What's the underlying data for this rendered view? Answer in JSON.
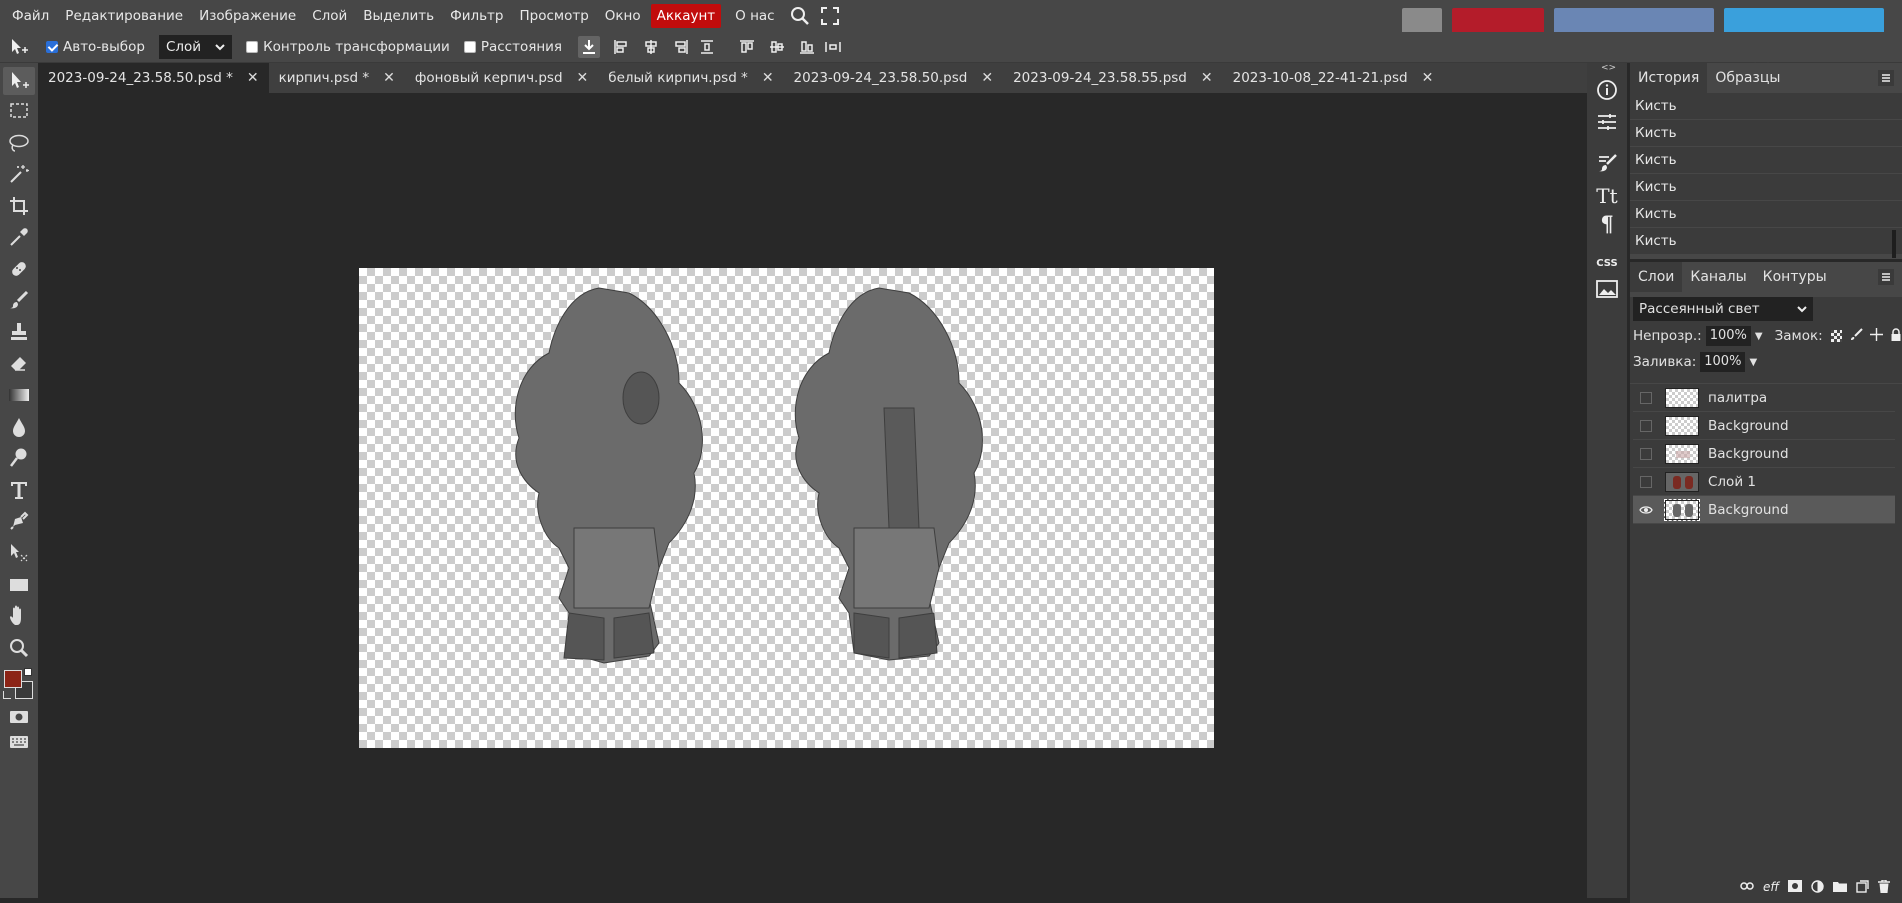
{
  "menubar": {
    "items": [
      "Файл",
      "Редактирование",
      "Изображение",
      "Слой",
      "Выделить",
      "Фильтр",
      "Просмотр",
      "Окно"
    ],
    "account": "Аккаунт",
    "about": "О нас"
  },
  "options": {
    "auto_select_label": "Авто-выбор",
    "auto_select_checked": true,
    "layer_select_value": "Слой",
    "transform_controls_label": "Контроль трансформации",
    "distances_label": "Расстояния"
  },
  "tabs": [
    {
      "label": "2023-09-24_23.58.50.psd *",
      "active": true
    },
    {
      "label": "кирпич.psd *",
      "active": false
    },
    {
      "label": "фоновый керпич.psd",
      "active": false
    },
    {
      "label": "белый кирпич.psd *",
      "active": false
    },
    {
      "label": "2023-09-24_23.58.50.psd",
      "active": false
    },
    {
      "label": "2023-09-24_23.58.55.psd",
      "active": false
    },
    {
      "label": "2023-10-08_22-41-21.psd",
      "active": false
    }
  ],
  "colors": {
    "foreground": "#8c2416",
    "background": "#3a3a3a",
    "account_red": "#c10c0c",
    "selected_layer": "#5a5a5a"
  },
  "history_panel": {
    "tabs": [
      "История",
      "Образцы"
    ],
    "items": [
      "Кисть",
      "Кисть",
      "Кисть",
      "Кисть",
      "Кисть",
      "Кисть"
    ]
  },
  "layers_panel": {
    "tabs": [
      "Слои",
      "Каналы",
      "Контуры"
    ],
    "blend_mode": "Рассеянный свет",
    "opacity_label": "Непрозр.:",
    "opacity_value": "100%",
    "lock_label": "Замок:",
    "fill_label": "Заливка:",
    "fill_value": "100%",
    "layers": [
      {
        "name": "палитра",
        "visible": false,
        "selected": false
      },
      {
        "name": "Background",
        "visible": false,
        "selected": false
      },
      {
        "name": "Background",
        "visible": false,
        "selected": false
      },
      {
        "name": "Слой 1",
        "visible": false,
        "selected": false
      },
      {
        "name": "Background",
        "visible": true,
        "selected": true
      }
    ]
  },
  "sidebar": {
    "css_label": "CSS"
  },
  "icons": {
    "tools": [
      "move-tool-icon",
      "marquee-tool-icon",
      "lasso-tool-icon",
      "magic-wand-icon",
      "crop-tool-icon",
      "eyedropper-icon",
      "healing-brush-icon",
      "brush-tool-icon",
      "clone-stamp-icon",
      "eraser-tool-icon",
      "gradient-tool-icon",
      "blur-tool-icon",
      "dodge-tool-icon",
      "type-tool-icon",
      "pen-tool-icon",
      "path-select-icon",
      "shape-tool-icon",
      "hand-tool-icon",
      "zoom-tool-icon"
    ]
  }
}
